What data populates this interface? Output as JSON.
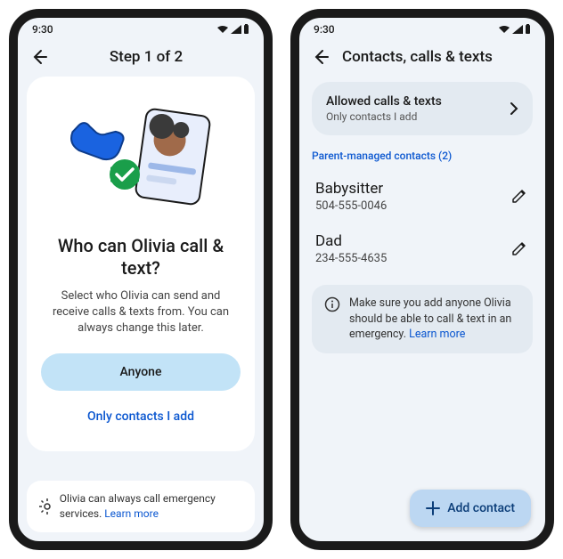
{
  "status": {
    "time": "9:30"
  },
  "left": {
    "header": "Step 1 of 2",
    "question": "Who can Olivia call & text?",
    "subtext": "Select who Olivia can send and receive calls & texts from. You can always change this later.",
    "primary_label": "Anyone",
    "secondary_label": "Only contacts I add",
    "footer_text": "Olivia can always call emergency services. ",
    "footer_link": "Learn more"
  },
  "right": {
    "header": "Contacts, calls & texts",
    "setting_title": "Allowed calls & texts",
    "setting_sub": "Only contacts I add",
    "section_label": "Parent-managed contacts (2)",
    "contacts": [
      {
        "name": "Babysitter",
        "phone": "504-555-0046"
      },
      {
        "name": "Dad",
        "phone": "234-555-4635"
      }
    ],
    "info_text": "Make sure you add anyone Olivia should be able to call & text in an emergency. ",
    "info_link": "Learn more",
    "fab_label": "Add contact"
  }
}
